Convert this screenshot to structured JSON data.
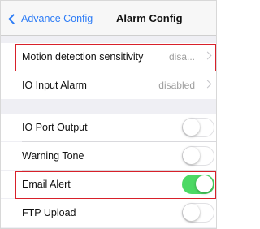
{
  "nav": {
    "back_label": "Advance Config",
    "title": "Alarm Config"
  },
  "rows": [
    {
      "label": "Motion detection sensitivity",
      "value": "disa...",
      "type": "disclosure"
    },
    {
      "label": "IO Input Alarm",
      "value": "disabled",
      "type": "disclosure"
    },
    {
      "label": "IO Port Output",
      "type": "toggle",
      "on": false
    },
    {
      "label": "Warning Tone",
      "type": "toggle",
      "on": false
    },
    {
      "label": "Email Alert",
      "type": "toggle",
      "on": true
    },
    {
      "label": "FTP Upload",
      "type": "toggle",
      "on": false
    }
  ],
  "colors": {
    "accent": "#2d7cf6",
    "toggle_on": "#4cd964",
    "highlight": "#d8202a"
  },
  "icons": {
    "back": "chevron-left-icon",
    "disclosure": "chevron-right-icon"
  }
}
